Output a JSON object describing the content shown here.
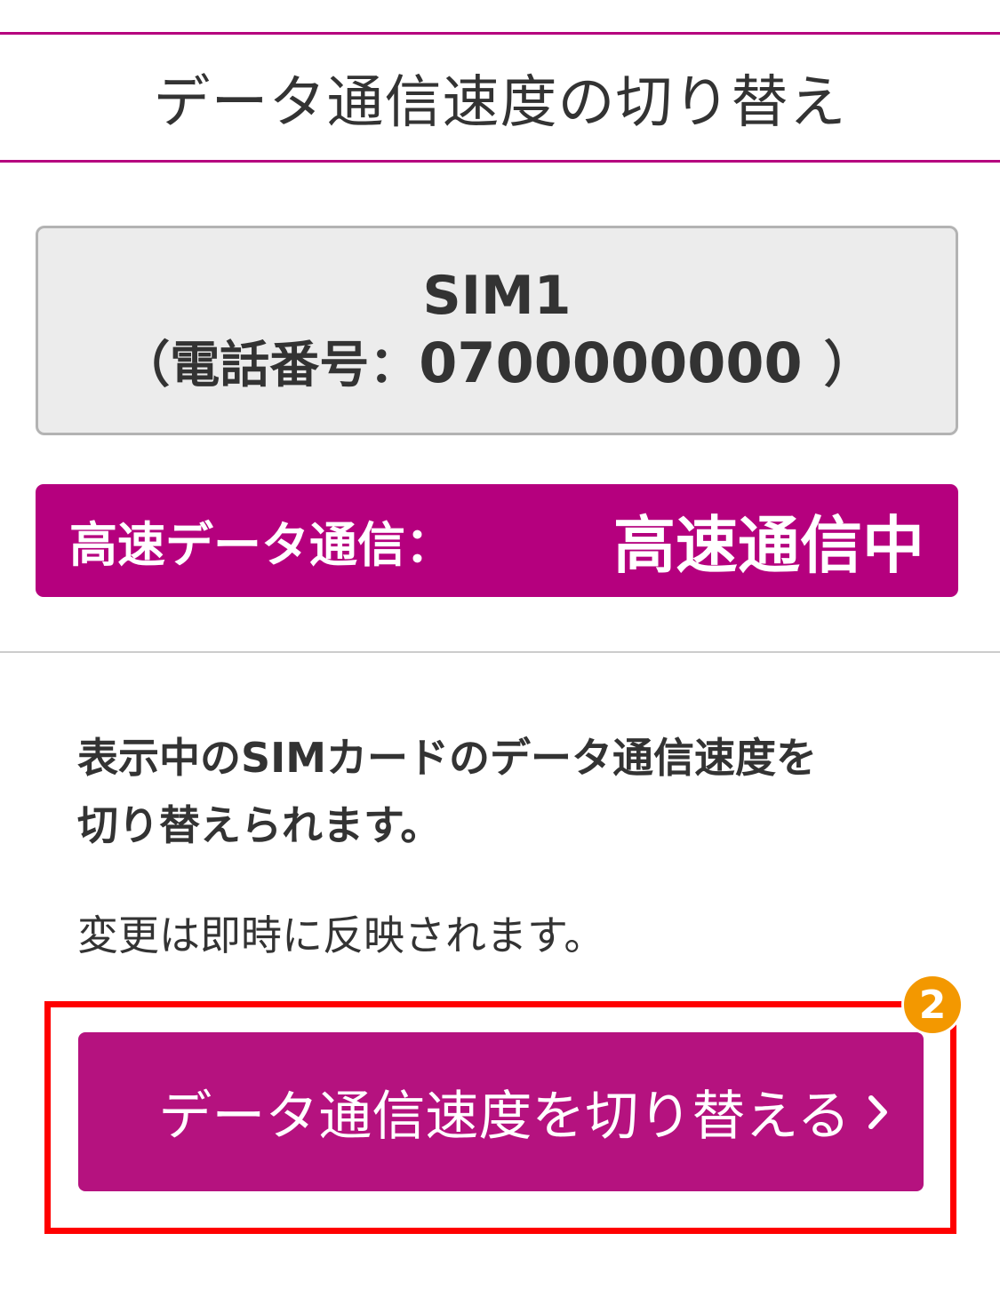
{
  "header": {
    "title": "データ通信速度の切り替え"
  },
  "sim": {
    "name": "SIM1",
    "phone_prefix": "（電話番号：",
    "phone_number": "0700000000",
    "phone_suffix": "）"
  },
  "status": {
    "label": "高速データ通信：",
    "value": "高速通信中"
  },
  "description": {
    "line1": "表示中のSIMカードのデータ通信速度を",
    "line2": "切り替えられます。",
    "note": "変更は即時に反映されます。"
  },
  "action": {
    "step_number": "2",
    "button_label": "データ通信速度を切り替える",
    "icon": "chevron-right-icon"
  },
  "colors": {
    "brand": "#b5007e",
    "highlight": "#ff0000",
    "badge": "#f39800",
    "sim_box_bg": "#ececec"
  }
}
